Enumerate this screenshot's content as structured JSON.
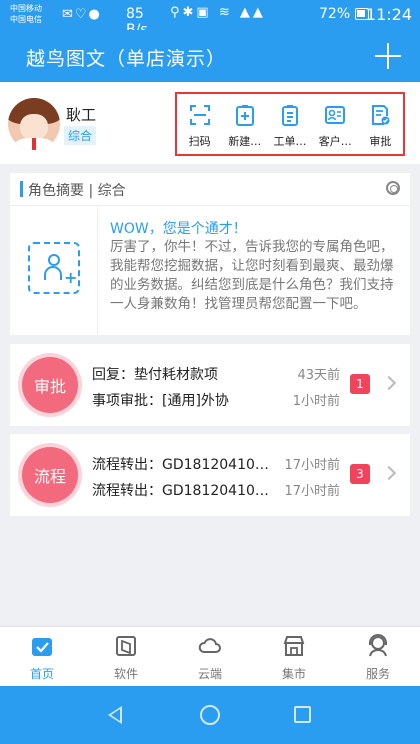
{
  "status_bar": {
    "carrier_1": "中国移动",
    "carrier_2": "中国电信",
    "net_speed": "85 B/s",
    "battery": "72%",
    "time": "11:24"
  },
  "header": {
    "title": "越鸟图文（单店演示）"
  },
  "profile": {
    "name": "耿工",
    "role": "综合"
  },
  "quick_actions": [
    {
      "label": "扫码",
      "icon": "scan-icon"
    },
    {
      "label": "新建…",
      "icon": "new-doc-icon"
    },
    {
      "label": "工单…",
      "icon": "work-order-icon"
    },
    {
      "label": "客户…",
      "icon": "customer-icon"
    },
    {
      "label": "审批",
      "icon": "approval-icon"
    }
  ],
  "role_summary": {
    "title": "角色摘要 | 综合",
    "promo_title": "WOW，您是个通才！",
    "promo_text": "厉害了，你牛！不过，告诉我您的专属角色吧，我能帮您挖掘数据，让您时刻看到最爽、最劲爆的业务数据。纠结您到底是什么角色？我们支持一人身兼数角！找管理员帮您配置一下吧。"
  },
  "messages": [
    {
      "type": "审批",
      "lines": [
        "回复：垫付耗材款项",
        "事项审批：[通用]外协"
      ],
      "times": [
        "43天前",
        "1小时前"
      ],
      "count": "1"
    },
    {
      "type": "流程",
      "lines": [
        "流程转出：GD18120410…",
        "流程转出：GD18120410…"
      ],
      "times": [
        "17小时前",
        "17小时前"
      ],
      "count": "3"
    }
  ],
  "bottom_nav": [
    {
      "label": "首页",
      "icon": "home-icon",
      "active": true
    },
    {
      "label": "软件",
      "icon": "software-icon",
      "active": false
    },
    {
      "label": "云端",
      "icon": "cloud-icon",
      "active": false
    },
    {
      "label": "集市",
      "icon": "market-icon",
      "active": false
    },
    {
      "label": "服务",
      "icon": "service-icon",
      "active": false
    }
  ],
  "colors": {
    "primary": "#2b9df0",
    "highlight_border": "#e53935",
    "badge": "#f0445a",
    "circle": "#f36a7e"
  }
}
